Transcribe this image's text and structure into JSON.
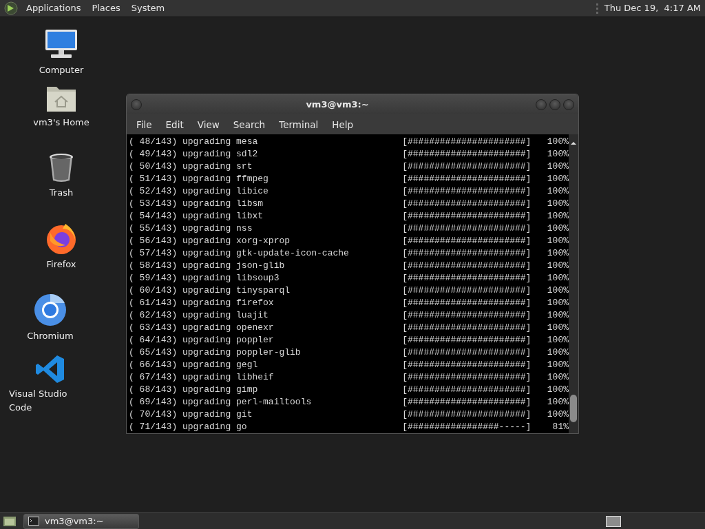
{
  "top_panel": {
    "menus": [
      "Applications",
      "Places",
      "System"
    ],
    "clock": "Thu Dec 19,  4:17 AM"
  },
  "desktop_icons": [
    {
      "label": "Computer",
      "kind": "computer"
    },
    {
      "label": "vm3's Home",
      "kind": "home"
    },
    {
      "label": "Trash",
      "kind": "trash"
    },
    {
      "label": "Firefox",
      "kind": "firefox"
    },
    {
      "label": "Chromium",
      "kind": "chromium"
    },
    {
      "label": "Visual Studio Code",
      "kind": "vscode"
    }
  ],
  "terminal": {
    "title": "vm3@vm3:~",
    "menus": [
      "File",
      "Edit",
      "View",
      "Search",
      "Terminal",
      "Help"
    ],
    "lines": [
      {
        "status": "( 48/143) upgrading mesa",
        "bar": "[######################]",
        "percent": "100%"
      },
      {
        "status": "( 49/143) upgrading sdl2",
        "bar": "[######################]",
        "percent": "100%"
      },
      {
        "status": "( 50/143) upgrading srt",
        "bar": "[######################]",
        "percent": "100%"
      },
      {
        "status": "( 51/143) upgrading ffmpeg",
        "bar": "[######################]",
        "percent": "100%"
      },
      {
        "status": "( 52/143) upgrading libice",
        "bar": "[######################]",
        "percent": "100%"
      },
      {
        "status": "( 53/143) upgrading libsm",
        "bar": "[######################]",
        "percent": "100%"
      },
      {
        "status": "( 54/143) upgrading libxt",
        "bar": "[######################]",
        "percent": "100%"
      },
      {
        "status": "( 55/143) upgrading nss",
        "bar": "[######################]",
        "percent": "100%"
      },
      {
        "status": "( 56/143) upgrading xorg-xprop",
        "bar": "[######################]",
        "percent": "100%"
      },
      {
        "status": "( 57/143) upgrading gtk-update-icon-cache",
        "bar": "[######################]",
        "percent": "100%"
      },
      {
        "status": "( 58/143) upgrading json-glib",
        "bar": "[######################]",
        "percent": "100%"
      },
      {
        "status": "( 59/143) upgrading libsoup3",
        "bar": "[######################]",
        "percent": "100%"
      },
      {
        "status": "( 60/143) upgrading tinysparql",
        "bar": "[######################]",
        "percent": "100%"
      },
      {
        "status": "( 61/143) upgrading firefox",
        "bar": "[######################]",
        "percent": "100%"
      },
      {
        "status": "( 62/143) upgrading luajit",
        "bar": "[######################]",
        "percent": "100%"
      },
      {
        "status": "( 63/143) upgrading openexr",
        "bar": "[######################]",
        "percent": "100%"
      },
      {
        "status": "( 64/143) upgrading poppler",
        "bar": "[######################]",
        "percent": "100%"
      },
      {
        "status": "( 65/143) upgrading poppler-glib",
        "bar": "[######################]",
        "percent": "100%"
      },
      {
        "status": "( 66/143) upgrading gegl",
        "bar": "[######################]",
        "percent": "100%"
      },
      {
        "status": "( 67/143) upgrading libheif",
        "bar": "[######################]",
        "percent": "100%"
      },
      {
        "status": "( 68/143) upgrading gimp",
        "bar": "[######################]",
        "percent": "100%"
      },
      {
        "status": "( 69/143) upgrading perl-mailtools",
        "bar": "[######################]",
        "percent": "100%"
      },
      {
        "status": "( 70/143) upgrading git",
        "bar": "[######################]",
        "percent": "100%"
      },
      {
        "status": "( 71/143) upgrading go",
        "bar": "[#################-----]",
        "percent": "81%"
      }
    ]
  },
  "taskbar": {
    "windows": [
      {
        "title": "vm3@vm3:~",
        "selected": true
      }
    ]
  }
}
